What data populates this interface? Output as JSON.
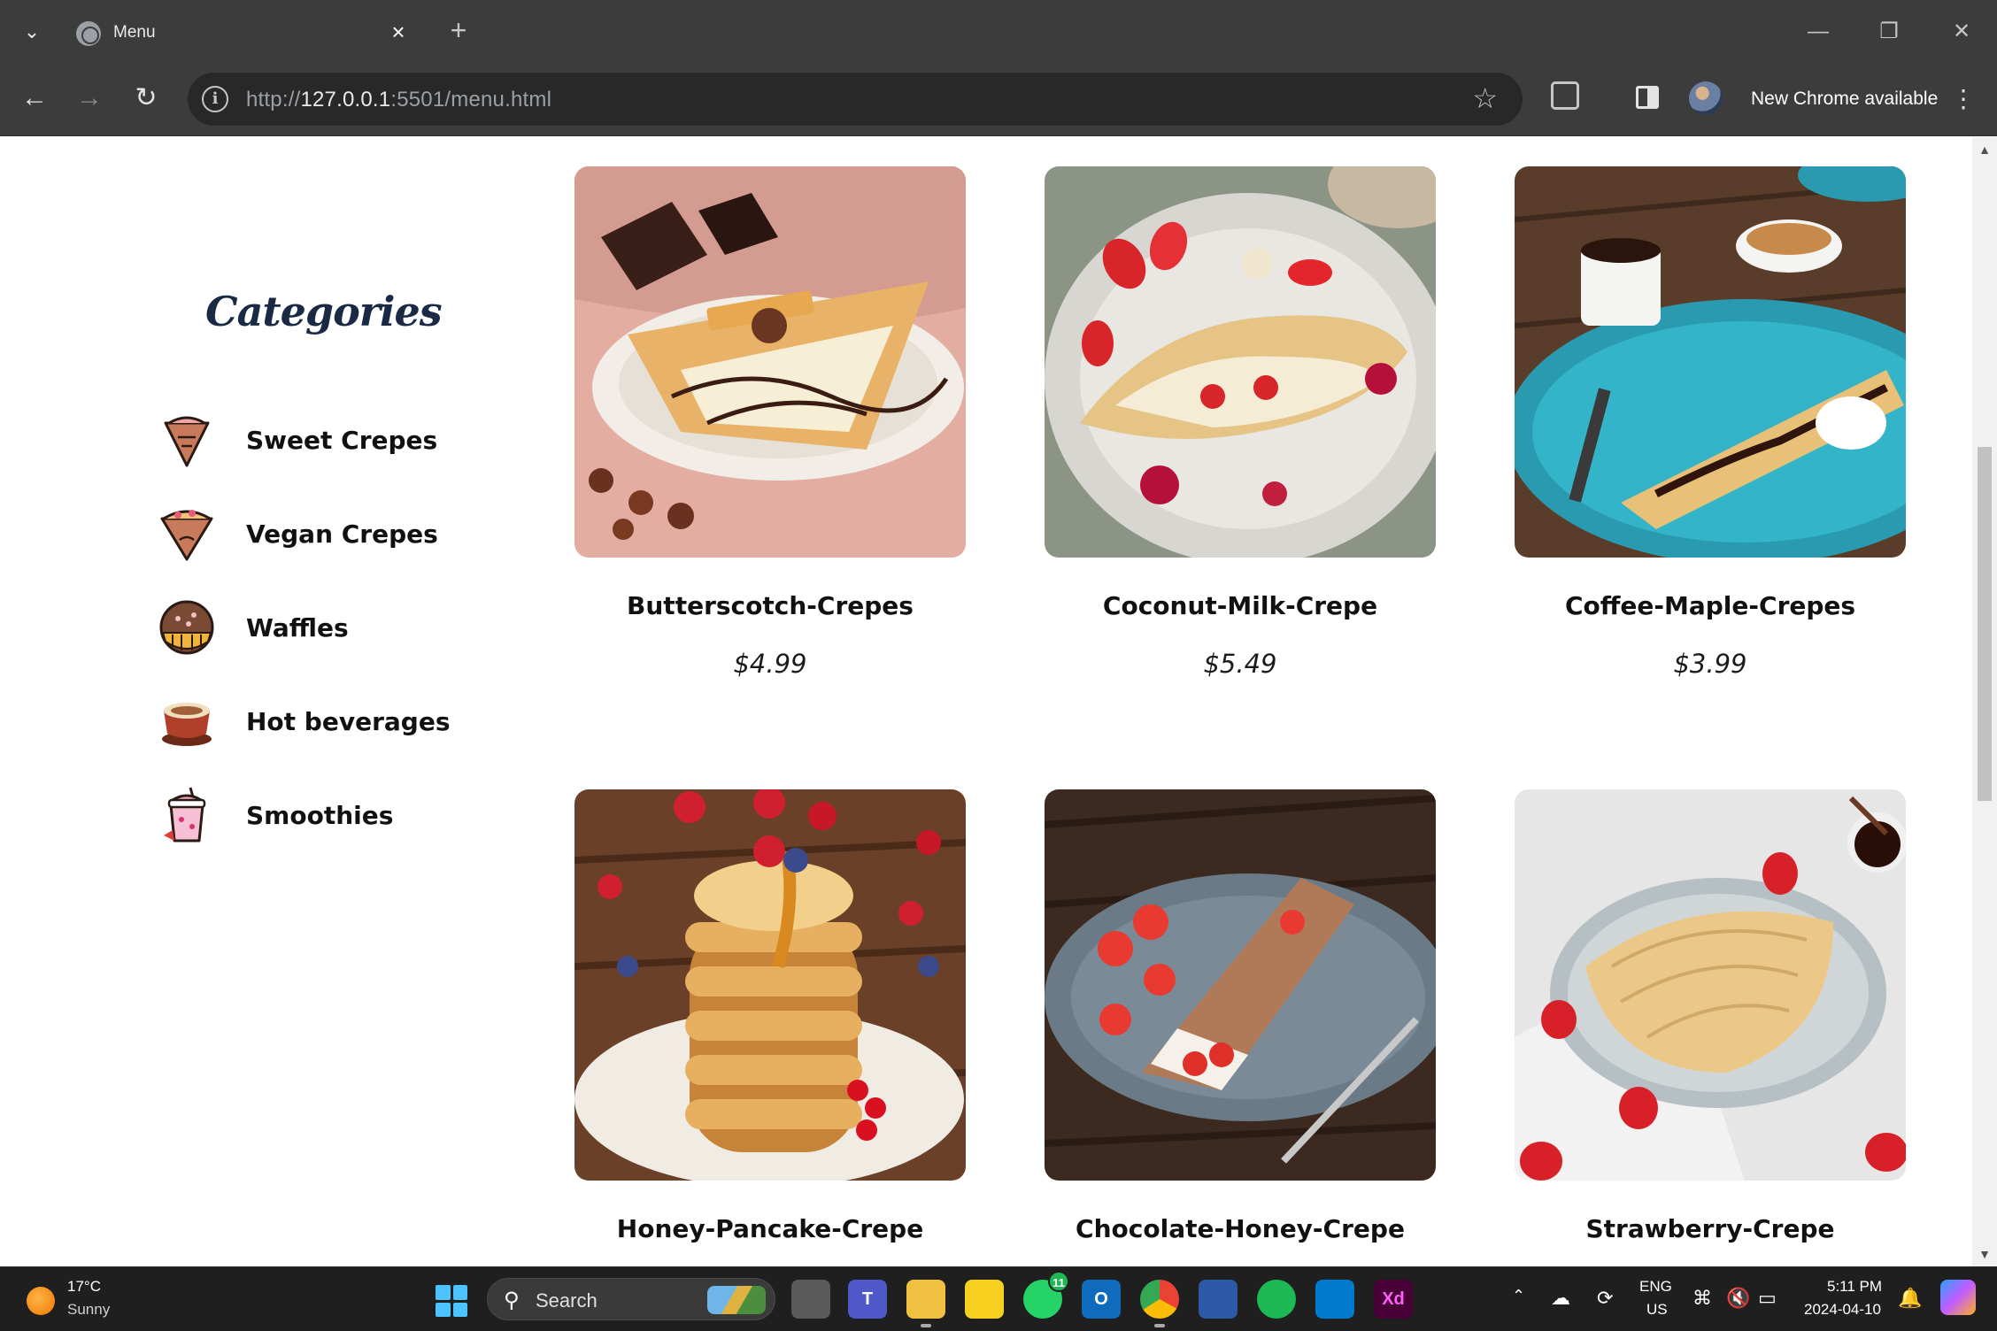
{
  "browser": {
    "tab_title": "Menu",
    "url_scheme": "http://",
    "url_host": "127.0.0.1",
    "url_rest": ":5501/menu.html",
    "update_label": "New Chrome available"
  },
  "sidebar": {
    "heading": "Categories",
    "items": [
      {
        "label": "Sweet Crepes",
        "icon": "crepe-icon"
      },
      {
        "label": "Vegan Crepes",
        "icon": "vegan-crepe-icon"
      },
      {
        "label": "Waffles",
        "icon": "waffle-icon"
      },
      {
        "label": "Hot beverages",
        "icon": "coffee-cup-icon"
      },
      {
        "label": "Smoothies",
        "icon": "smoothie-icon"
      }
    ]
  },
  "products": [
    {
      "name": "Butterscotch-Crepes",
      "price": "$4.99"
    },
    {
      "name": "Coconut-Milk-Crepe",
      "price": "$5.49"
    },
    {
      "name": "Coffee-Maple-Crepes",
      "price": "$3.99"
    },
    {
      "name": "Honey-Pancake-Crepe",
      "price": ""
    },
    {
      "name": "Chocolate-Honey-Crepe",
      "price": ""
    },
    {
      "name": "Strawberry-Crepe",
      "price": ""
    }
  ],
  "taskbar": {
    "weather_temp": "17°C",
    "weather_desc": "Sunny",
    "search_placeholder": "Search",
    "teams_badge": "11",
    "lang_top": "ENG",
    "lang_bottom": "US",
    "time": "5:11 PM",
    "date": "2024-04-10"
  }
}
